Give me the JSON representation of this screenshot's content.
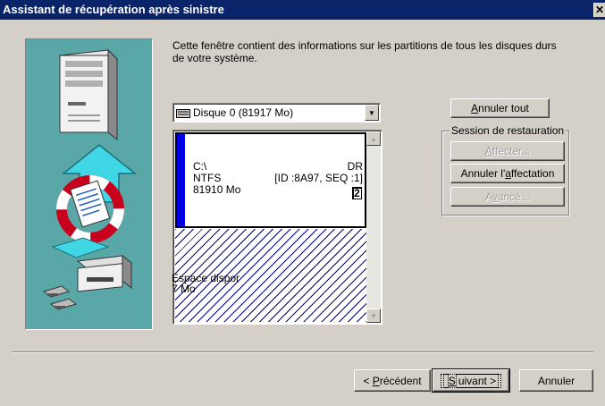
{
  "window": {
    "title": "Assistant de récupération après sinistre",
    "close_glyph": "✕"
  },
  "intro_text": "Cette fenêtre contient des informations sur les partitions de tous les disques durs de votre système.",
  "disk_select": {
    "selected": "Disque 0  (81917 Mo)"
  },
  "partitions": [
    {
      "drive": "C:\\",
      "filesystem": "NTFS",
      "size": "81910 Mo",
      "label": "DR",
      "id": "[ID :8A97, SEQ :1]",
      "badge": "2"
    },
    {
      "free_label": "Espace dispor",
      "free_size": "7 Mo"
    }
  ],
  "buttons": {
    "cancel_all_pre": "",
    "cancel_all_u": "A",
    "cancel_all_post": "nnuler tout",
    "assign_pre": "",
    "assign_u": "A",
    "assign_post": "ffecter...",
    "unassign_pre": "Annuler l'",
    "unassign_u": "a",
    "unassign_post": "ffectation",
    "advanced_pre": "A",
    "advanced_u": "v",
    "advanced_post": "ancé...",
    "previous_pre": "< ",
    "previous_u": "P",
    "previous_post": "récédent",
    "next_pre": "",
    "next_u": "S",
    "next_post": "uivant >",
    "cancel": "Annuler"
  },
  "group_label": "Session de restauration",
  "colors": {
    "titlebar": "#0a246a",
    "illustration": "#5aa7a7",
    "partition_bar": "#0000e0",
    "hatch": "#000080"
  }
}
